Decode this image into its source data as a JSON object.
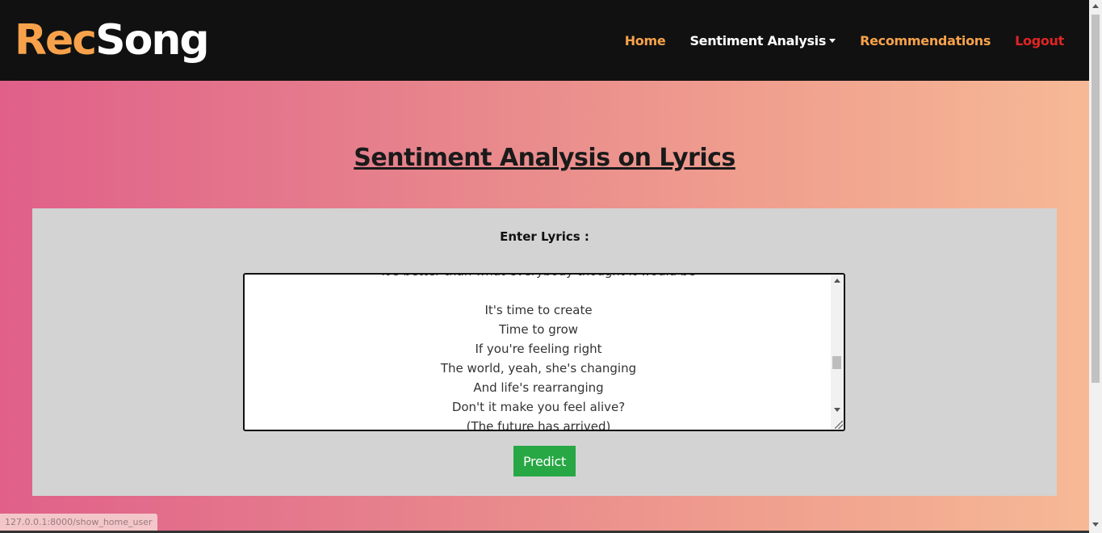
{
  "brand": {
    "part1": "Rec",
    "part2": "Song",
    "accent_color": "#f7a24b"
  },
  "nav": {
    "items": [
      {
        "label": "Home",
        "color": "#f7a24b"
      },
      {
        "label": "Sentiment Analysis",
        "color": "#ffffff",
        "has_dropdown": true
      },
      {
        "label": "Recommendations",
        "color": "#f7a24b"
      },
      {
        "label": "Logout",
        "color": "#e02424"
      }
    ],
    "dropdown_icon": "caret-down-icon"
  },
  "main": {
    "title": "Sentiment Analysis on Lyrics",
    "form": {
      "label": "Enter Lyrics :",
      "lyrics_lines": [
        "It's better than what everybody thought it would be",
        "",
        "It's time to create",
        "Time to grow",
        "If you're feeling right",
        "The world, yeah, she's changing",
        "And life's rearranging",
        "Don't it make you feel alive?",
        "(The future has arrived)"
      ],
      "submit_label": "Predict",
      "submit_color": "#28a745"
    }
  },
  "status_bar": {
    "url": "127.0.0.1:8000/show_home_user"
  }
}
